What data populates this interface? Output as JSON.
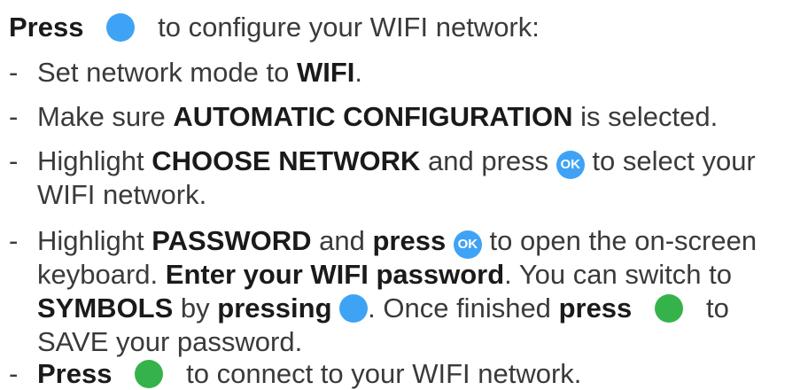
{
  "colors": {
    "blue_button": "#3fa3f5",
    "green_button": "#35b34a",
    "text": "#3a3a3a"
  },
  "icons": {
    "blue": "blue-button-icon",
    "green": "green-button-icon",
    "ok": "ok-button-icon"
  },
  "dash": "-",
  "intro": {
    "bold": "Press",
    "rest": "to configure your WIFI network:"
  },
  "step1": {
    "a": "Set network mode to",
    "b": "WIFI",
    "c": "."
  },
  "step2": {
    "a": "Make sure",
    "b": "AUTOMATIC CONFIGURATION",
    "c": "is selected."
  },
  "step3": {
    "a": "Highlight",
    "b": "CHOOSE NETWORK",
    "c": "and press",
    "ok": "OK",
    "d": "to select your",
    "line2": "WIFI network."
  },
  "step4": {
    "a": "Highlight",
    "b": "PASSWORD",
    "c": "and",
    "d": "press",
    "ok": "OK",
    "e": "to open the on-screen",
    "l2a": "keyboard.",
    "l2b": "Enter your WIFI password",
    "l2c": ". You can switch to",
    "l3a": "SYMBOLS",
    "l3b": "by",
    "l3c": "pressing",
    "l3d": ". Once finished",
    "l3e": "press",
    "l3f": "to",
    "l4": "SAVE your password."
  },
  "step5": {
    "a": "Press",
    "b": "to connect to your WIFI network."
  }
}
